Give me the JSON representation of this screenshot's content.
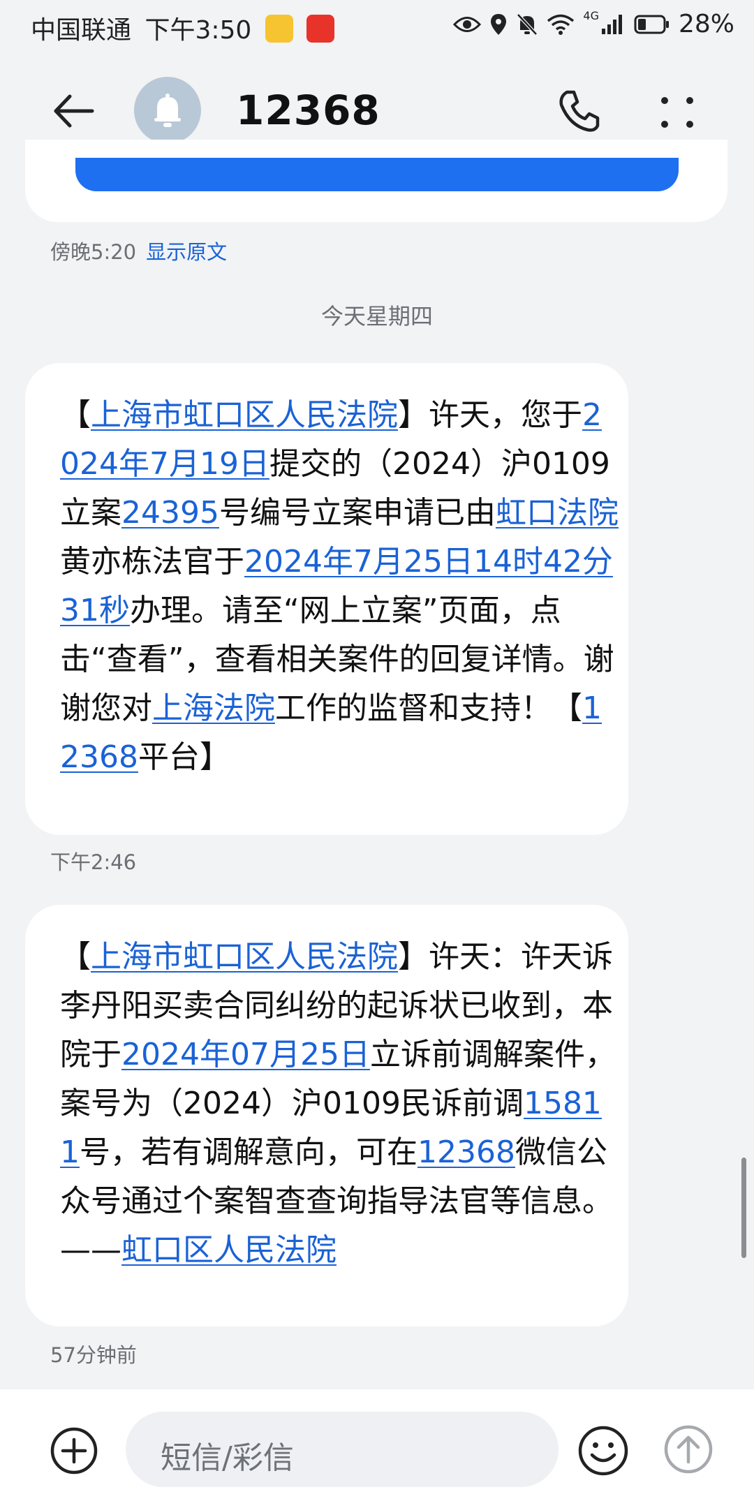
{
  "status_bar": {
    "carrier": "中国联通",
    "time": "下午3:50",
    "network": "4G",
    "battery": "28%"
  },
  "header": {
    "back_icon": "arrow-left-icon",
    "avatar_icon": "bell-icon",
    "title": "12368",
    "call_icon": "phone-icon",
    "more_icon": "more-dots-icon"
  },
  "previous_message": {
    "time": "傍晚5:20",
    "show_original": "显示原文"
  },
  "date_separator": "今天星期四",
  "messages": [
    {
      "segments": [
        {
          "text": "【",
          "link": false
        },
        {
          "text": "上海市虹口区人民法院",
          "link": true
        },
        {
          "text": "】许天，您于",
          "link": false
        },
        {
          "text": "2024年7月19日",
          "link": true
        },
        {
          "text": "提交的（2024）沪0109立案",
          "link": false
        },
        {
          "text": "24395",
          "link": true
        },
        {
          "text": "号编号立案申请已由",
          "link": false
        },
        {
          "text": "虹口法院",
          "link": true
        },
        {
          "text": "黄亦栋法官于",
          "link": false
        },
        {
          "text": "2024年7月25日14时42分31秒",
          "link": true
        },
        {
          "text": "办理。请至“网上立案”页面，点击“查看”，查看相关案件的回复详情。谢谢您对",
          "link": false
        },
        {
          "text": "上海法院",
          "link": true
        },
        {
          "text": "工作的监督和支持！【",
          "link": false
        },
        {
          "text": "12368",
          "link": true
        },
        {
          "text": "平台】",
          "link": false
        }
      ],
      "time": "下午2:46"
    },
    {
      "segments": [
        {
          "text": "【",
          "link": false
        },
        {
          "text": "上海市虹口区人民法院",
          "link": true
        },
        {
          "text": "】许天：许天诉李丹阳买卖合同纠纷的起诉状已收到，本院于",
          "link": false
        },
        {
          "text": "2024年07月25日",
          "link": true
        },
        {
          "text": "立诉前调解案件，案号为（2024）沪0109民诉前调",
          "link": false
        },
        {
          "text": "15811",
          "link": true
        },
        {
          "text": "号，若有调解意向，可在",
          "link": false
        },
        {
          "text": "12368",
          "link": true
        },
        {
          "text": "微信公众号通过个案智查查询指导法官等信息。——",
          "link": false
        },
        {
          "text": "虹口区人民法院",
          "link": true
        }
      ],
      "time": "57分钟前"
    }
  ],
  "input_bar": {
    "placeholder": "短信/彩信",
    "add_icon": "plus-circle-icon",
    "emoji_icon": "smiley-icon",
    "send_icon": "send-arrow-icon"
  },
  "colors": {
    "background": "#f1f3f5",
    "link": "#1a62d6",
    "bubble": "#ffffff",
    "card_button": "#1f6ff1"
  }
}
